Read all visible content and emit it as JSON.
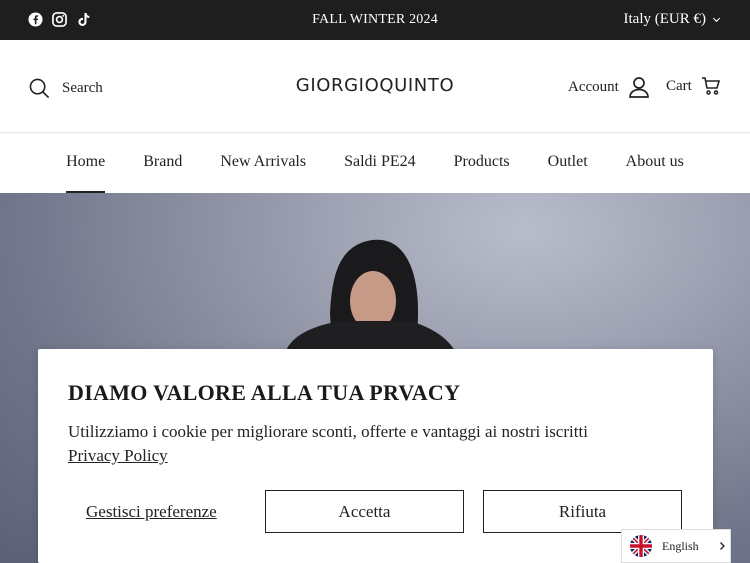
{
  "topbar": {
    "social_icons": [
      "facebook-icon",
      "instagram-icon",
      "tiktok-icon"
    ],
    "announcement": "FALL WINTER 2024",
    "region": "Italy (EUR €)"
  },
  "header": {
    "search_label": "Search",
    "logo": "GIORGIOQUINTO",
    "account_label": "Account",
    "cart_label": "Cart"
  },
  "nav": {
    "items": [
      {
        "label": "Home",
        "active": true
      },
      {
        "label": "Brand"
      },
      {
        "label": "New Arrivals"
      },
      {
        "label": "Saldi PE24"
      },
      {
        "label": "Products"
      },
      {
        "label": "Outlet"
      },
      {
        "label": "About us"
      }
    ]
  },
  "cookie": {
    "title": "DIAMO VALORE ALLA TUA PRVACY",
    "text": "Utilizziamo i cookie per migliorare sconti, offerte e vantaggi ai nostri iscritti",
    "policy_link": "Privacy Policy",
    "manage_label": "Gestisci preferenze",
    "accept_label": "Accetta",
    "reject_label": "Rifiuta"
  },
  "language": {
    "label": "English",
    "flag": "uk-flag-icon"
  },
  "colors": {
    "topbar_bg": "#1e1e1e",
    "text": "#222222"
  }
}
